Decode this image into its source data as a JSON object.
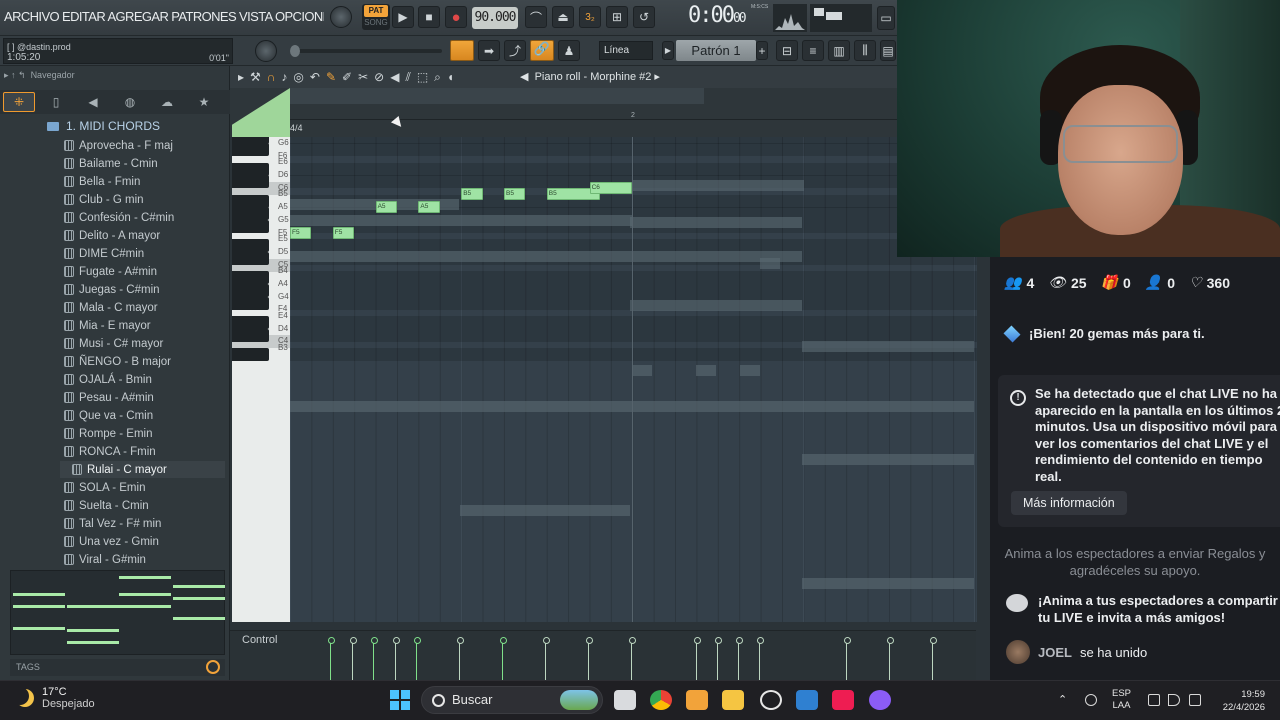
{
  "fl": {
    "menu": "ARCHIVO EDITAR AGREGAR PATRONES VISTA OPCIONES HERRAMIENTAS AYU",
    "pat_label": "PAT",
    "song_label": "SONG",
    "tempo": "90.000",
    "clock_main": "0:00",
    "clock_sub": "00",
    "clock_unit": "M:S:CS",
    "hint_user": "@dastin.prod",
    "hint_bracket": "[ ]",
    "hint_pos": "1:05:20",
    "hint_time": "0'01\"",
    "snap": "Línea",
    "pattern": "Patrón 1"
  },
  "browser": {
    "title": "Navegador",
    "folder": "1. MIDI CHORDS",
    "items": [
      "Aprovecha - F maj",
      "Bailame - Cmin",
      "Bella - Fmin",
      "Club - G min",
      "Confesión - C#min",
      "Delito - A mayor",
      "DIME C#min",
      "Fugate - A#min",
      "Juegas  - C#min",
      "Mala - C mayor",
      "Mia - E mayor",
      "Musi - C# mayor",
      "ÑENGO - B major",
      "OJALÁ - Bmin",
      "Pesau - A#min",
      "Que va - Cmin",
      "Rompe - Emin",
      "RONCA - Fmin",
      "Rulai - C mayor",
      "SOLA - Emin",
      "Suelta - Cmin",
      "Tal Vez - F# min",
      "Una vez - Gmin",
      "Viral - G#min"
    ],
    "selected_index": 18,
    "tags_label": "TAGS"
  },
  "piano_roll": {
    "title": "Piano roll - Morphine #2",
    "time_signature": "4/4",
    "bar_marker": "2",
    "key_labels": [
      "G6",
      "F6",
      "E6",
      "D6",
      "C6",
      "B5",
      "A5",
      "G5",
      "F5",
      "E5",
      "D5",
      "C5",
      "B4",
      "A4",
      "G4",
      "F4",
      "E4",
      "D4",
      "C4",
      "B3"
    ],
    "notes": [
      {
        "label": "F5",
        "pitch": "F5",
        "start": 0,
        "length": 1
      },
      {
        "label": "F5",
        "pitch": "F5",
        "start": 2,
        "length": 1
      },
      {
        "label": "A5",
        "pitch": "A5",
        "start": 4,
        "length": 1
      },
      {
        "label": "A5",
        "pitch": "A5",
        "start": 6,
        "length": 1
      },
      {
        "label": "B5",
        "pitch": "B5",
        "start": 8,
        "length": 1
      },
      {
        "label": "B5",
        "pitch": "B5",
        "start": 10,
        "length": 1
      },
      {
        "label": "B5",
        "pitch": "B5",
        "start": 12,
        "length": 2.5
      },
      {
        "label": "C6",
        "pitch": "C6",
        "start": 14,
        "length": 2
      }
    ],
    "velocity_label": "Control"
  },
  "live": {
    "stats": {
      "viewers_group": "4",
      "views": "25",
      "gifts": "0",
      "shares": "0",
      "likes": "360"
    },
    "gems_msg": "¡Bien! 20 gemas más para ti.",
    "alert_msg": "Se ha detectado que el chat LIVE no ha aparecido en la pantalla en los últimos 2 minutos. Usa un dispositivo móvil para ver los comentarios del chat LIVE y el rendimiento del contenido en tiempo real.",
    "more_info": "Más información",
    "gifts_hint": "Anima a los espectadores a enviar Regalos y agradéceles su apoyo.",
    "share_msg": "¡Anima a tus espectadores a compartir tu LIVE e invita a más amigos!",
    "joined_name": "JOEL",
    "joined_text": "se ha unido"
  },
  "taskbar": {
    "temp": "17°C",
    "weather": "Despejado",
    "search": "Buscar",
    "lang1": "ESP",
    "lang2": "LAA",
    "time": "19:59",
    "date": "22/4/2026"
  }
}
